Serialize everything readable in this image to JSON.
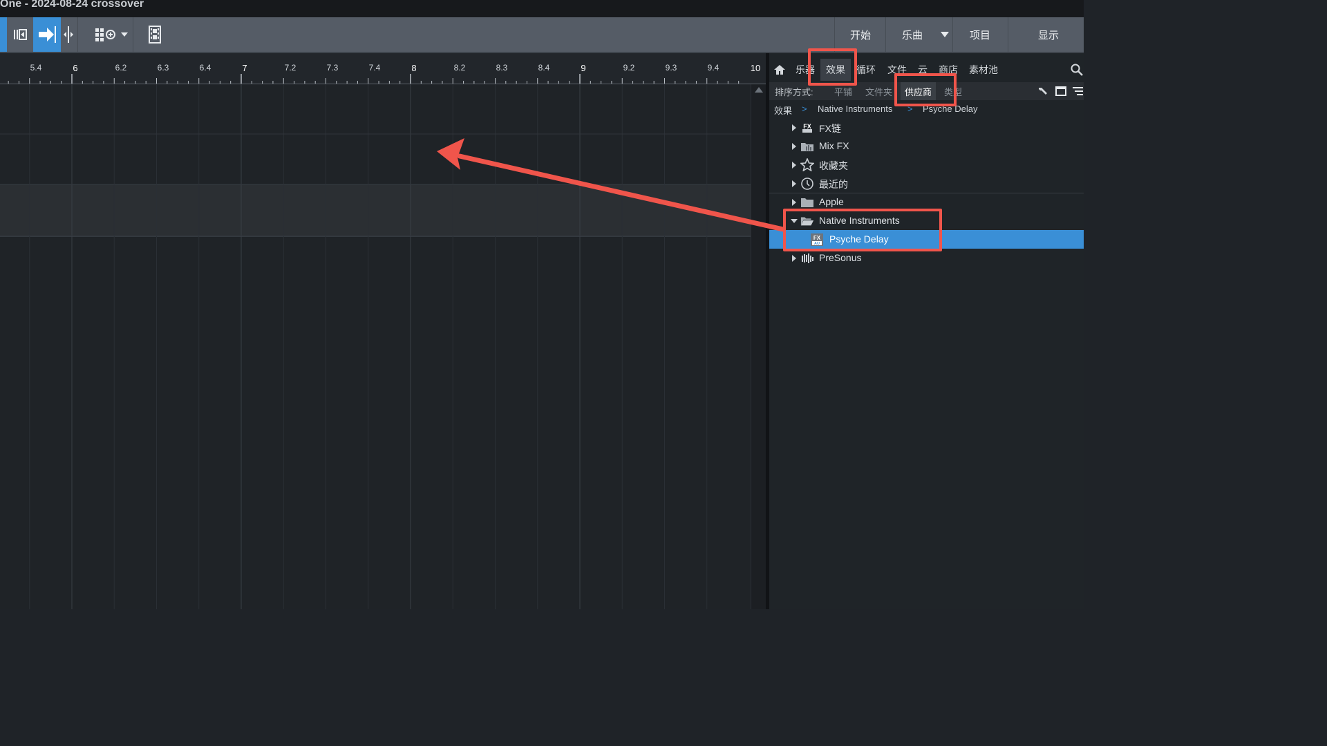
{
  "window": {
    "title": "One - 2024-08-24 crossover"
  },
  "toolbar": {
    "nav": {
      "start": "开始",
      "song": "乐曲",
      "project": "项目",
      "show": "显示"
    }
  },
  "ruler": {
    "labels": [
      "5.4",
      "6",
      "6.2",
      "6.3",
      "6.4",
      "7",
      "7.2",
      "7.3",
      "7.4",
      "8",
      "8.2",
      "8.3",
      "8.4",
      "9",
      "9.2",
      "9.3",
      "9.4",
      "10"
    ]
  },
  "browser": {
    "tabs": {
      "instruments": "乐器",
      "effects": "效果",
      "loops": "循环",
      "files": "文件",
      "cloud": "云",
      "shop": "商店",
      "pool": "素材池"
    },
    "sort": {
      "label": "排序方式:",
      "flat": "平铺",
      "folder": "文件夹",
      "vendor": "供应商",
      "type": "类型"
    },
    "breadcrumb": {
      "root": "效果",
      "vendor": "Native Instruments",
      "item": "Psyche Delay"
    },
    "tree": {
      "fxchain": "FX链",
      "mixfx": "Mix FX",
      "favorites": "收藏夹",
      "recent": "最近的",
      "apple": "Apple",
      "native": "Native Instruments",
      "psyche": "Psyche Delay",
      "presonus": "PreSonus"
    },
    "icon_badges": {
      "fx": "FX",
      "au": "AU"
    }
  },
  "colors": {
    "accent": "#3a8fd6",
    "annotation": "#f0554b"
  }
}
